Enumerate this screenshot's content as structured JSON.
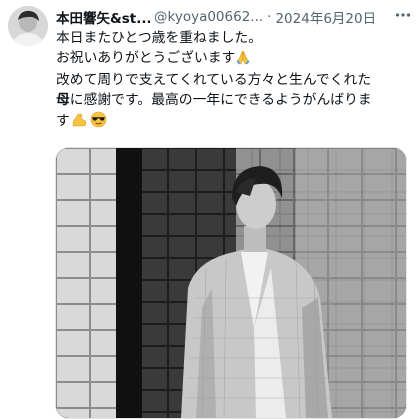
{
  "tweet": {
    "author_name": "本田響矢&st...",
    "handle": "@kyoya00662...",
    "separator": "·",
    "date": "2024年6月20日",
    "text_lines": [
      "本日またひとつ歳を重ねました。",
      "お祝いありがとうございます",
      "改めて周りで支えてくれている方々と生んでくれた",
      "母に感謝です。最高の一年にできるようがんばりま",
      "す"
    ],
    "icons": {
      "avatar": "profile-avatar",
      "more": "more-icon",
      "pray": "folded-hands-emoji",
      "muscle": "flexed-biceps-emoji",
      "sunglasses": "sunglasses-face-emoji"
    },
    "media": "black-and-white-photo"
  },
  "colors": {
    "text": "#0f1419",
    "secondary": "#536471",
    "background": "#ffffff"
  }
}
